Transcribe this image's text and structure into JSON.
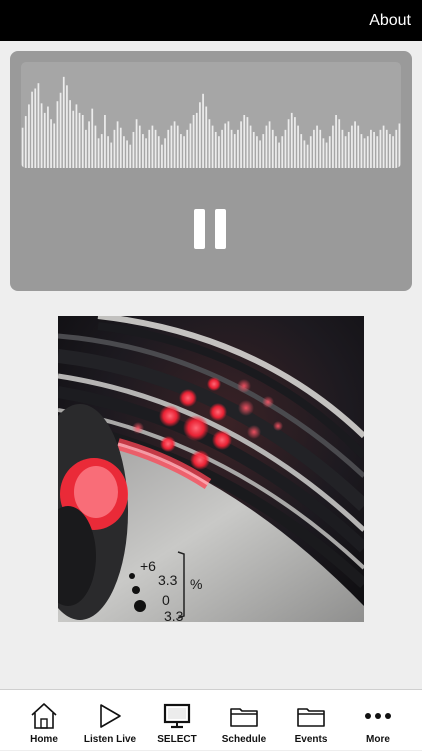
{
  "header": {
    "about_label": "About"
  },
  "player": {
    "waveform_levels": [
      0.38,
      0.49,
      0.6,
      0.72,
      0.75,
      0.8,
      0.61,
      0.52,
      0.58,
      0.46,
      0.42,
      0.63,
      0.71,
      0.86,
      0.78,
      0.64,
      0.54,
      0.6,
      0.52,
      0.5,
      0.36,
      0.44,
      0.56,
      0.4,
      0.28,
      0.32,
      0.5,
      0.3,
      0.24,
      0.36,
      0.44,
      0.38,
      0.3,
      0.26,
      0.22,
      0.34,
      0.46,
      0.4,
      0.32,
      0.28,
      0.36,
      0.4,
      0.36,
      0.3,
      0.22,
      0.28,
      0.36,
      0.4,
      0.44,
      0.4,
      0.32,
      0.3,
      0.36,
      0.42,
      0.5,
      0.52,
      0.62,
      0.7,
      0.58,
      0.46,
      0.4,
      0.34,
      0.3,
      0.36,
      0.42,
      0.44,
      0.36,
      0.32,
      0.36,
      0.44,
      0.5,
      0.48,
      0.4,
      0.34,
      0.3,
      0.26,
      0.32,
      0.4,
      0.44,
      0.36,
      0.3,
      0.24,
      0.3,
      0.36,
      0.46,
      0.52,
      0.48,
      0.4,
      0.32,
      0.26,
      0.22,
      0.3,
      0.36,
      0.4,
      0.36,
      0.28,
      0.24,
      0.3,
      0.4,
      0.5,
      0.46,
      0.36,
      0.3,
      0.34,
      0.4,
      0.44,
      0.4,
      0.32,
      0.28,
      0.3,
      0.36,
      0.34,
      0.3,
      0.36,
      0.4,
      0.36,
      0.32,
      0.3,
      0.36,
      0.42
    ],
    "state": "playing",
    "pause_icon": "pause-icon"
  },
  "artwork": {
    "icon": "turntable-artwork",
    "pitch_labels": [
      "+6",
      "3.3",
      "0",
      "3.3"
    ],
    "pitch_unit": "%"
  },
  "tabs": [
    {
      "label": "Home",
      "icon": "home-icon",
      "name": "tab-home"
    },
    {
      "label": "Listen Live",
      "icon": "play-icon",
      "name": "tab-listen-live"
    },
    {
      "label": "SELECT",
      "icon": "monitor-icon",
      "name": "tab-select"
    },
    {
      "label": "Schedule",
      "icon": "folder-icon",
      "name": "tab-schedule"
    },
    {
      "label": "Events",
      "icon": "folder-icon",
      "name": "tab-events"
    },
    {
      "label": "More",
      "icon": "more-icon",
      "name": "tab-more"
    }
  ],
  "colors": {
    "topbar": "#000000",
    "page_background": "#eeeeee",
    "player_card": "#9a9a9a",
    "waveform_bars": "#ececec",
    "led_red": "#ff3344"
  }
}
